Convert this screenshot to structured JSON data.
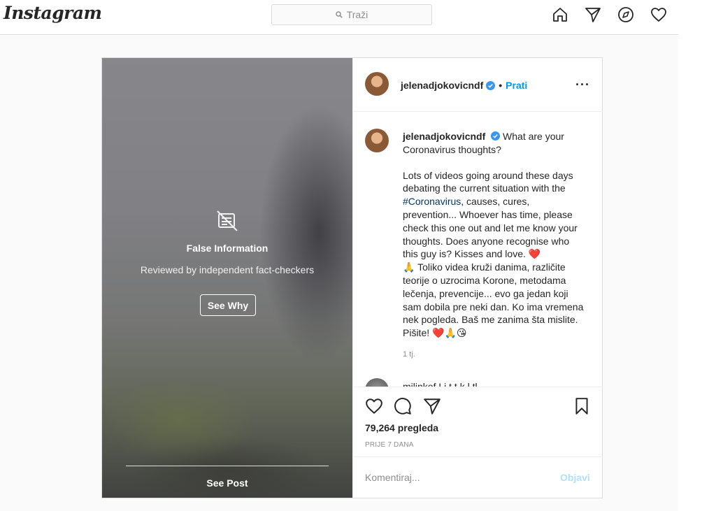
{
  "app": {
    "logo_text": "Instagram"
  },
  "search": {
    "placeholder": "Traži"
  },
  "nav": {
    "icons": [
      "home-icon",
      "direct-icon",
      "explore-icon",
      "activity-icon"
    ]
  },
  "media": {
    "overlay_title": "False Information",
    "overlay_subtitle": "Reviewed by independent fact-checkers",
    "see_why_label": "See Why",
    "see_post_label": "See Post"
  },
  "post": {
    "username": "jelenadjokovicndf",
    "separator": "•",
    "follow_label": "Prati",
    "more_label": "···",
    "caption": {
      "username": "jelenadjokovicndf",
      "line1": "What are your Coronavirus thoughts?",
      "p2_before": "Lots of videos going around these days debating the current situation with the ",
      "hashtag": "#Coronavirus",
      "p2_after": ", causes, cures, prevention... Whoever has time, please check this one out and let me know your thoughts. Does anyone recognise who this guy is? Kisses and love. ❤️",
      "p3": "🙏 Toliko videa kruži danima, različite teorije o uzrocima Korone, metodama lečenja, prevencije... evo ga jedan koji sam dobila pre neki dan. Ko ima vremena nek pogleda. Baš me zanima šta mislite. Pišite! ❤️🙏😘"
    },
    "time_ago": "1 tj.",
    "next_comment_partial": "milinkof   Li   t   t   k   l   tl",
    "views": "79,264 pregleda",
    "date": "PRIJE 7 DANA",
    "comment_placeholder": "Komentiraj...",
    "post_button_label": "Objavi"
  },
  "colors": {
    "accent": "#0095f6",
    "hashtag": "#00376b",
    "muted": "#8e8e8e",
    "post_disabled": "#b2dffc"
  }
}
